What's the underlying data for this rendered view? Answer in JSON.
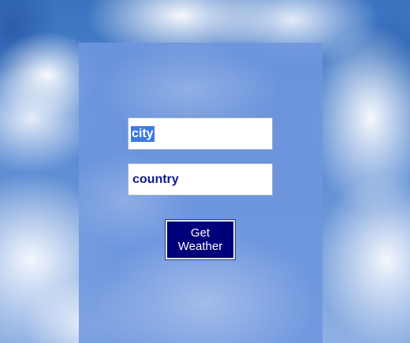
{
  "form": {
    "city": {
      "value": "",
      "placeholder": "city",
      "selected_text": "city"
    },
    "country": {
      "value": "",
      "placeholder": "country"
    },
    "submit_label": "Get Weather"
  },
  "colors": {
    "panel": "#6e96de",
    "button": "#00007a",
    "input_text": "#0a1a8c",
    "selection": "#3d7ae6"
  }
}
